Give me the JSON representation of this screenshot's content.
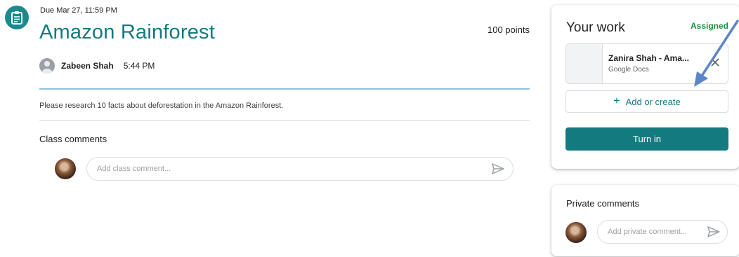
{
  "assignment": {
    "icon": "assignment-icon",
    "due": "Due Mar 27, 11:59 PM",
    "title": "Amazon Rainforest",
    "points": "100 points",
    "author_name": "Zabeen Shah",
    "posted_time": "5:44 PM",
    "instructions": "Please research 10 facts about deforestation in the Amazon Rainforest."
  },
  "class_comments": {
    "label": "Class comments",
    "placeholder": "Add class comment...",
    "send_icon": "send-icon"
  },
  "your_work": {
    "heading": "Your work",
    "status": "Assigned",
    "attachment": {
      "name": "Zanira Shah - Ama...",
      "type": "Google Docs",
      "remove_icon": "close-icon"
    },
    "add_create_label": "Add or create",
    "turn_in_label": "Turn in"
  },
  "private_comments": {
    "label": "Private comments",
    "placeholder": "Add private comment..."
  },
  "colors": {
    "accent": "#137a7f",
    "status_green": "#1e8e3e",
    "annotation_arrow": "#5b86c6"
  }
}
